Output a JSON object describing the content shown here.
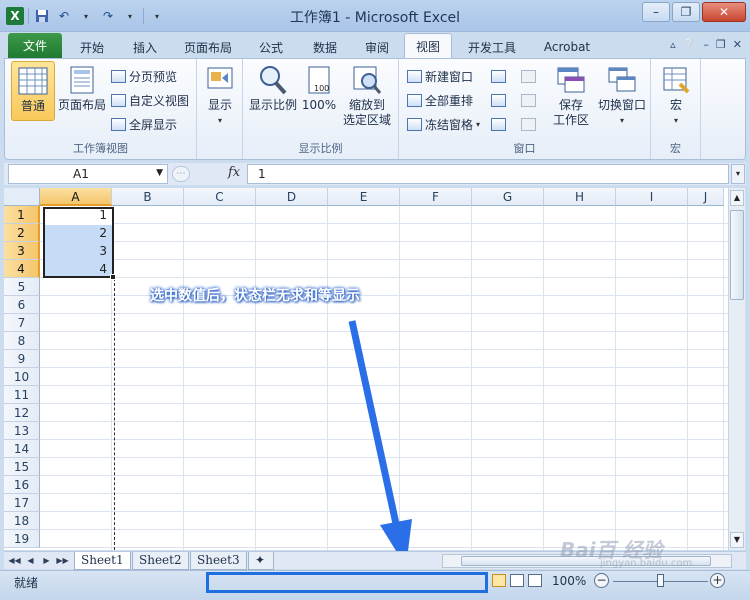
{
  "window": {
    "title": "工作簿1 - Microsoft Excel",
    "app_logo": "X"
  },
  "qat": {
    "save_icon": "save-icon",
    "undo_icon": "undo-icon",
    "redo_icon": "redo-icon"
  },
  "tabs": {
    "file": "文件",
    "items": [
      "开始",
      "插入",
      "页面布局",
      "公式",
      "数据",
      "审阅",
      "视图",
      "开发工具",
      "Acrobat"
    ],
    "active": "视图"
  },
  "ribbon": {
    "workbook_views": {
      "label": "工作簿视图",
      "normal": "普通",
      "page_layout": "页面布局",
      "page_break_preview": "分页预览",
      "custom_views": "自定义视图",
      "full_screen": "全屏显示"
    },
    "show": {
      "label": "显示"
    },
    "zoom": {
      "label": "显示比例",
      "zoom": "显示比例",
      "hundred": "100%",
      "zoom_to_selection_1": "缩放到",
      "zoom_to_selection_2": "选定区域"
    },
    "window": {
      "label": "窗口",
      "new_window": "新建窗口",
      "arrange_all": "全部重排",
      "freeze_panes": "冻结窗格",
      "save_workspace_1": "保存",
      "save_workspace_2": "工作区",
      "switch_windows": "切换窗口"
    },
    "macros": {
      "label": "宏",
      "macros": "宏"
    }
  },
  "formula_bar": {
    "name_box": "A1",
    "fx": "fx",
    "value": "1"
  },
  "grid": {
    "columns": [
      "A",
      "B",
      "C",
      "D",
      "E",
      "F",
      "G",
      "H",
      "I",
      "J"
    ],
    "rows": [
      "1",
      "2",
      "3",
      "4",
      "5",
      "6",
      "7",
      "8",
      "9",
      "10",
      "11",
      "12",
      "13",
      "14",
      "15",
      "16",
      "17",
      "18",
      "19"
    ],
    "cells": [
      "1",
      "2",
      "3",
      "4"
    ],
    "selected_column": "A",
    "selected_rows": [
      "1",
      "2",
      "3",
      "4"
    ]
  },
  "annotation": "选中数值后，状态栏无求和等显示",
  "sheets": [
    "Sheet1",
    "Sheet2",
    "Sheet3"
  ],
  "active_sheet": "Sheet1",
  "status": {
    "ready": "就绪",
    "zoom": "100%",
    "zoom_level": 100
  },
  "watermark": {
    "main": "Bai百 经验",
    "sub": "jingyan.baidu.com"
  },
  "colors": {
    "accent": "#1f6fe0",
    "file_tab": "#2a8a3c",
    "selection": "#c6dcf6"
  }
}
